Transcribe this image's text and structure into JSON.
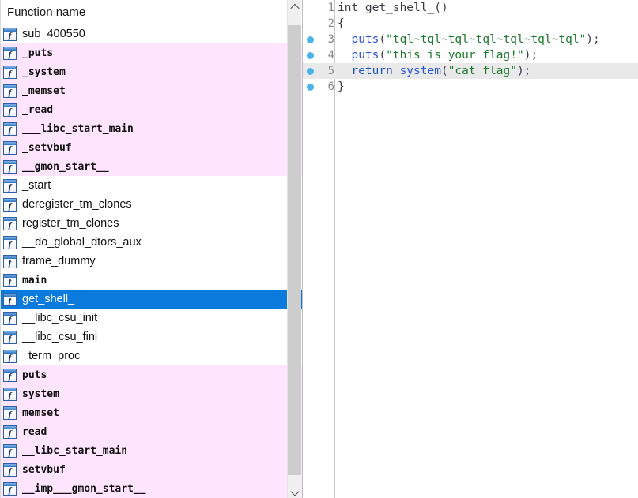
{
  "left_panel": {
    "header": "Function name",
    "rows": [
      {
        "name": "sub_400550",
        "style": "prop",
        "kind": "normal"
      },
      {
        "name": "_puts",
        "style": "mono",
        "kind": "library"
      },
      {
        "name": "_system",
        "style": "mono",
        "kind": "library"
      },
      {
        "name": "_memset",
        "style": "mono",
        "kind": "library"
      },
      {
        "name": "_read",
        "style": "mono",
        "kind": "library"
      },
      {
        "name": "___libc_start_main",
        "style": "mono",
        "kind": "library"
      },
      {
        "name": "_setvbuf",
        "style": "mono",
        "kind": "library"
      },
      {
        "name": "__gmon_start__",
        "style": "mono",
        "kind": "library"
      },
      {
        "name": "_start",
        "style": "prop",
        "kind": "normal"
      },
      {
        "name": "deregister_tm_clones",
        "style": "prop",
        "kind": "normal"
      },
      {
        "name": "register_tm_clones",
        "style": "prop",
        "kind": "normal"
      },
      {
        "name": "__do_global_dtors_aux",
        "style": "prop",
        "kind": "normal"
      },
      {
        "name": "frame_dummy",
        "style": "prop",
        "kind": "normal"
      },
      {
        "name": "main",
        "style": "mono",
        "kind": "normal"
      },
      {
        "name": "get_shell_",
        "style": "prop",
        "kind": "selected"
      },
      {
        "name": "__libc_csu_init",
        "style": "prop",
        "kind": "normal"
      },
      {
        "name": "__libc_csu_fini",
        "style": "prop",
        "kind": "normal"
      },
      {
        "name": "_term_proc",
        "style": "prop",
        "kind": "normal"
      },
      {
        "name": "puts",
        "style": "mono",
        "kind": "library"
      },
      {
        "name": "system",
        "style": "mono",
        "kind": "library"
      },
      {
        "name": "memset",
        "style": "mono",
        "kind": "library"
      },
      {
        "name": "read",
        "style": "mono",
        "kind": "library"
      },
      {
        "name": "__libc_start_main",
        "style": "mono",
        "kind": "library"
      },
      {
        "name": "setvbuf",
        "style": "mono",
        "kind": "library"
      },
      {
        "name": "__imp___gmon_start__",
        "style": "mono",
        "kind": "library"
      }
    ],
    "scrollbar": {
      "up_arrow": "chevron-up",
      "down_arrow": "chevron-down"
    }
  },
  "code_panel": {
    "lines": [
      {
        "number": "1",
        "breakpoint": false,
        "current": false,
        "tokens": [
          {
            "t": "int ",
            "c": "plain"
          },
          {
            "t": "get_shell_",
            "c": "plain"
          },
          {
            "t": "()",
            "c": "plain"
          }
        ]
      },
      {
        "number": "2",
        "breakpoint": false,
        "current": false,
        "tokens": [
          {
            "t": "{",
            "c": "plain"
          }
        ]
      },
      {
        "number": "3",
        "breakpoint": true,
        "current": false,
        "tokens": [
          {
            "t": "  ",
            "c": "plain"
          },
          {
            "t": "puts",
            "c": "fn"
          },
          {
            "t": "(",
            "c": "punc"
          },
          {
            "t": "\"tql~tql~tql~tql~tql~tql~tql\"",
            "c": "str"
          },
          {
            "t": ");",
            "c": "punc"
          }
        ]
      },
      {
        "number": "4",
        "breakpoint": true,
        "current": false,
        "tokens": [
          {
            "t": "  ",
            "c": "plain"
          },
          {
            "t": "puts",
            "c": "fn"
          },
          {
            "t": "(",
            "c": "punc"
          },
          {
            "t": "\"this is your flag!\"",
            "c": "str"
          },
          {
            "t": ");",
            "c": "punc"
          }
        ]
      },
      {
        "number": "5",
        "breakpoint": true,
        "current": true,
        "tokens": [
          {
            "t": "  ",
            "c": "plain"
          },
          {
            "t": "return ",
            "c": "kw"
          },
          {
            "t": "system",
            "c": "fn"
          },
          {
            "t": "(",
            "c": "punc"
          },
          {
            "t": "\"cat flag\"",
            "c": "str"
          },
          {
            "t": ");",
            "c": "punc"
          }
        ]
      },
      {
        "number": "6",
        "breakpoint": true,
        "current": false,
        "tokens": [
          {
            "t": "}",
            "c": "plain"
          }
        ]
      }
    ]
  },
  "colors": {
    "selection_blue": "#0a7bdc",
    "library_pink": "#ffe4fd",
    "current_line_gray": "#e9e9e9",
    "breakpoint_dot": "#4cb3e8",
    "string_green": "#1c7a2e",
    "keyword_blue": "#1f4fc4",
    "function_blue": "#2a52d8",
    "line_number_gray": "#8a8a8a"
  }
}
